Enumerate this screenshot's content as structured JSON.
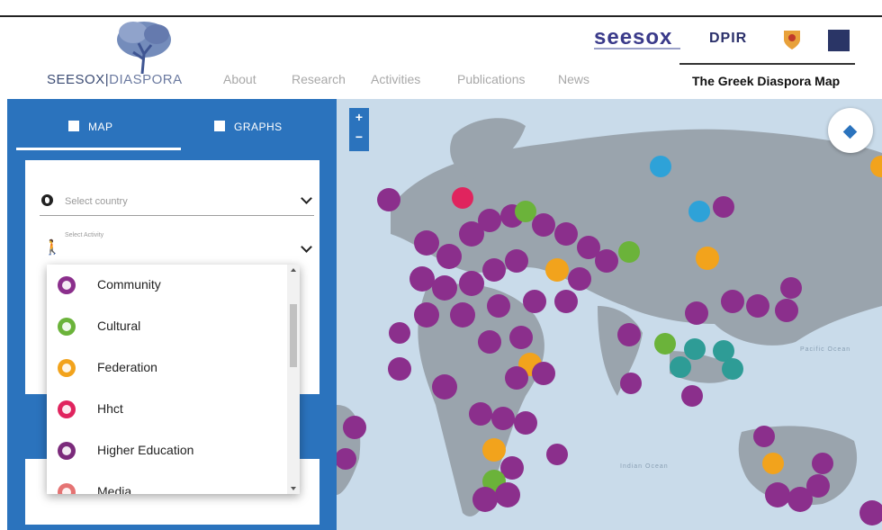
{
  "header": {
    "logo_part1": "SEESOX",
    "logo_part2": "DIASPORA",
    "nav": [
      "About",
      "Research",
      "Activities",
      "Publications",
      "News"
    ],
    "partners": {
      "seesox": "seesox",
      "dpir": "DPIR"
    },
    "active_tab": "The Greek Diaspora Map"
  },
  "panel": {
    "tabs": [
      {
        "label": "MAP",
        "icon": "map-icon"
      },
      {
        "label": "GRAPHS",
        "icon": "bar-chart-icon"
      }
    ],
    "country_select": {
      "placeholder": "Select country",
      "icon": "globe-icon"
    },
    "activity_select": {
      "label": "Select Activity",
      "icon": "walking-person-icon"
    }
  },
  "dropdown": {
    "options": [
      {
        "label": "Community",
        "color": "#8b2f8c"
      },
      {
        "label": "Cultural",
        "color": "#6bb33a"
      },
      {
        "label": "Federation",
        "color": "#f2a31c"
      },
      {
        "label": "Hhct",
        "color": "#e0245e"
      },
      {
        "label": "Higher Education",
        "color": "#7b2a7b"
      },
      {
        "label": "Media",
        "color": "#e57373"
      }
    ]
  },
  "map": {
    "zoom_in": "+",
    "zoom_out": "−",
    "labels": [
      "Pacific Ocean",
      "Indian Ocean"
    ],
    "marker_colors": {
      "community": "#8b2f8c",
      "cultural": "#6bb33a",
      "federation": "#f2a31c",
      "hhct": "#e0245e",
      "science": "#2e9c96",
      "other": "#2ea2d8"
    }
  }
}
